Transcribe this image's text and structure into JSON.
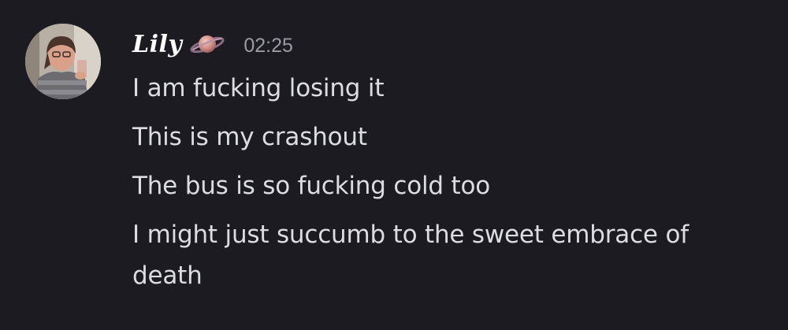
{
  "message": {
    "author": "Lily",
    "author_badge_icon": "ringed-planet-icon",
    "timestamp": "02:25",
    "lines": [
      "I am fucking losing it",
      "This is my crashout",
      "The bus is so fucking cold too",
      "I might just succumb to the sweet embrace of death"
    ]
  },
  "colors": {
    "background": "#1b1b21",
    "text": "#dcdde1",
    "username": "#ffffff",
    "timestamp": "#9a9ba3"
  }
}
